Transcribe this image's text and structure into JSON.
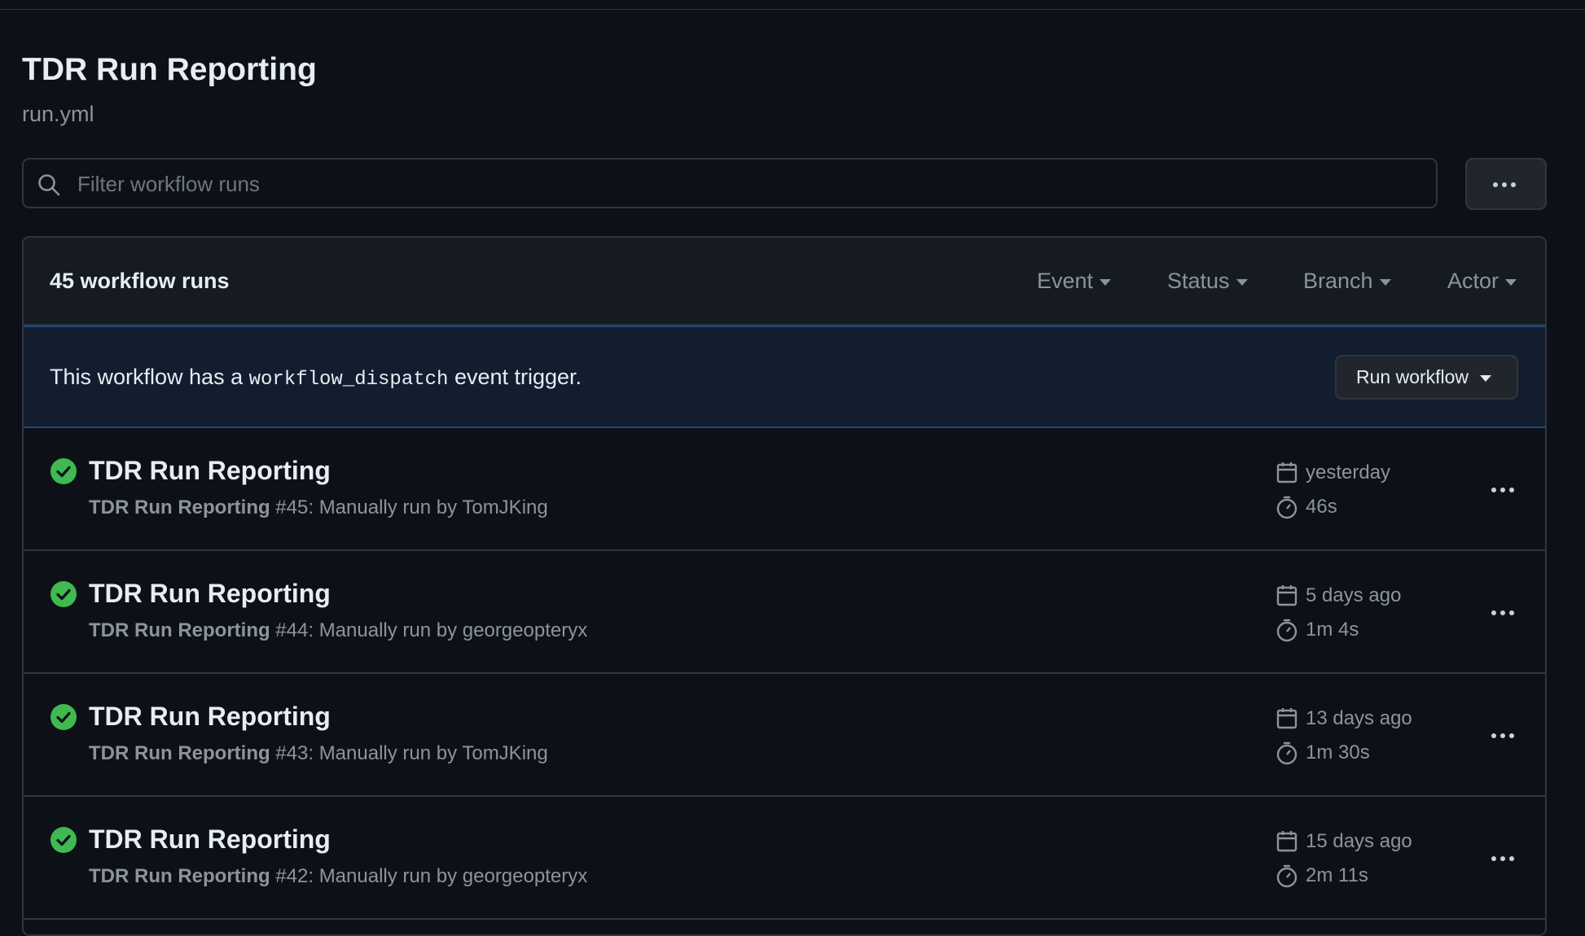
{
  "page": {
    "title": "TDR Run Reporting",
    "subtitle": "run.yml"
  },
  "filter": {
    "placeholder": "Filter workflow runs",
    "value": ""
  },
  "header": {
    "run_count": "45 workflow runs",
    "filters": [
      "Event",
      "Status",
      "Branch",
      "Actor"
    ]
  },
  "dispatch": {
    "prefix": "This workflow has a ",
    "code": "workflow_dispatch",
    "suffix": " event trigger.",
    "button_label": "Run workflow"
  },
  "colors": {
    "background": "#0d1117",
    "success": "#3fb950",
    "accent_border": "#1f4a80"
  },
  "runs": [
    {
      "title": "TDR Run Reporting",
      "workflow": "TDR Run Reporting",
      "detail": " #45: Manually run by TomJKing",
      "date": "yesterday",
      "duration": "46s",
      "status": "success"
    },
    {
      "title": "TDR Run Reporting",
      "workflow": "TDR Run Reporting",
      "detail": " #44: Manually run by georgeopteryx",
      "date": "5 days ago",
      "duration": "1m 4s",
      "status": "success"
    },
    {
      "title": "TDR Run Reporting",
      "workflow": "TDR Run Reporting",
      "detail": " #43: Manually run by TomJKing",
      "date": "13 days ago",
      "duration": "1m 30s",
      "status": "success"
    },
    {
      "title": "TDR Run Reporting",
      "workflow": "TDR Run Reporting",
      "detail": " #42: Manually run by georgeopteryx",
      "date": "15 days ago",
      "duration": "2m 11s",
      "status": "success"
    }
  ]
}
